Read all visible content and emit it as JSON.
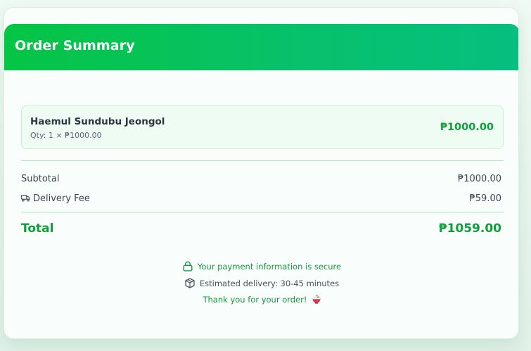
{
  "header": {
    "title": "Order Summary"
  },
  "item": {
    "name": "Haemul Sundubu Jeongol",
    "qty_line": "Qty: 1 × ₱1000.00",
    "price": "₱1000.00"
  },
  "summary": {
    "subtotal_label": "Subtotal",
    "subtotal_value": "₱1000.00",
    "delivery_label": "Delivery Fee",
    "delivery_value": "₱59.00",
    "total_label": "Total",
    "total_value": "₱1059.00"
  },
  "footer": {
    "secure": "Your payment information is secure",
    "estimate": "Estimated delivery: 30-45 minutes",
    "thanks": "Thank you for your order!"
  },
  "icons": {
    "delivery": "truck-icon",
    "secure": "lock-icon",
    "estimate": "package-icon",
    "thanks": "bowl-icon"
  },
  "colors": {
    "accent": "#0e9f3a",
    "header_start": "#05c545",
    "header_end": "#06bf80"
  }
}
